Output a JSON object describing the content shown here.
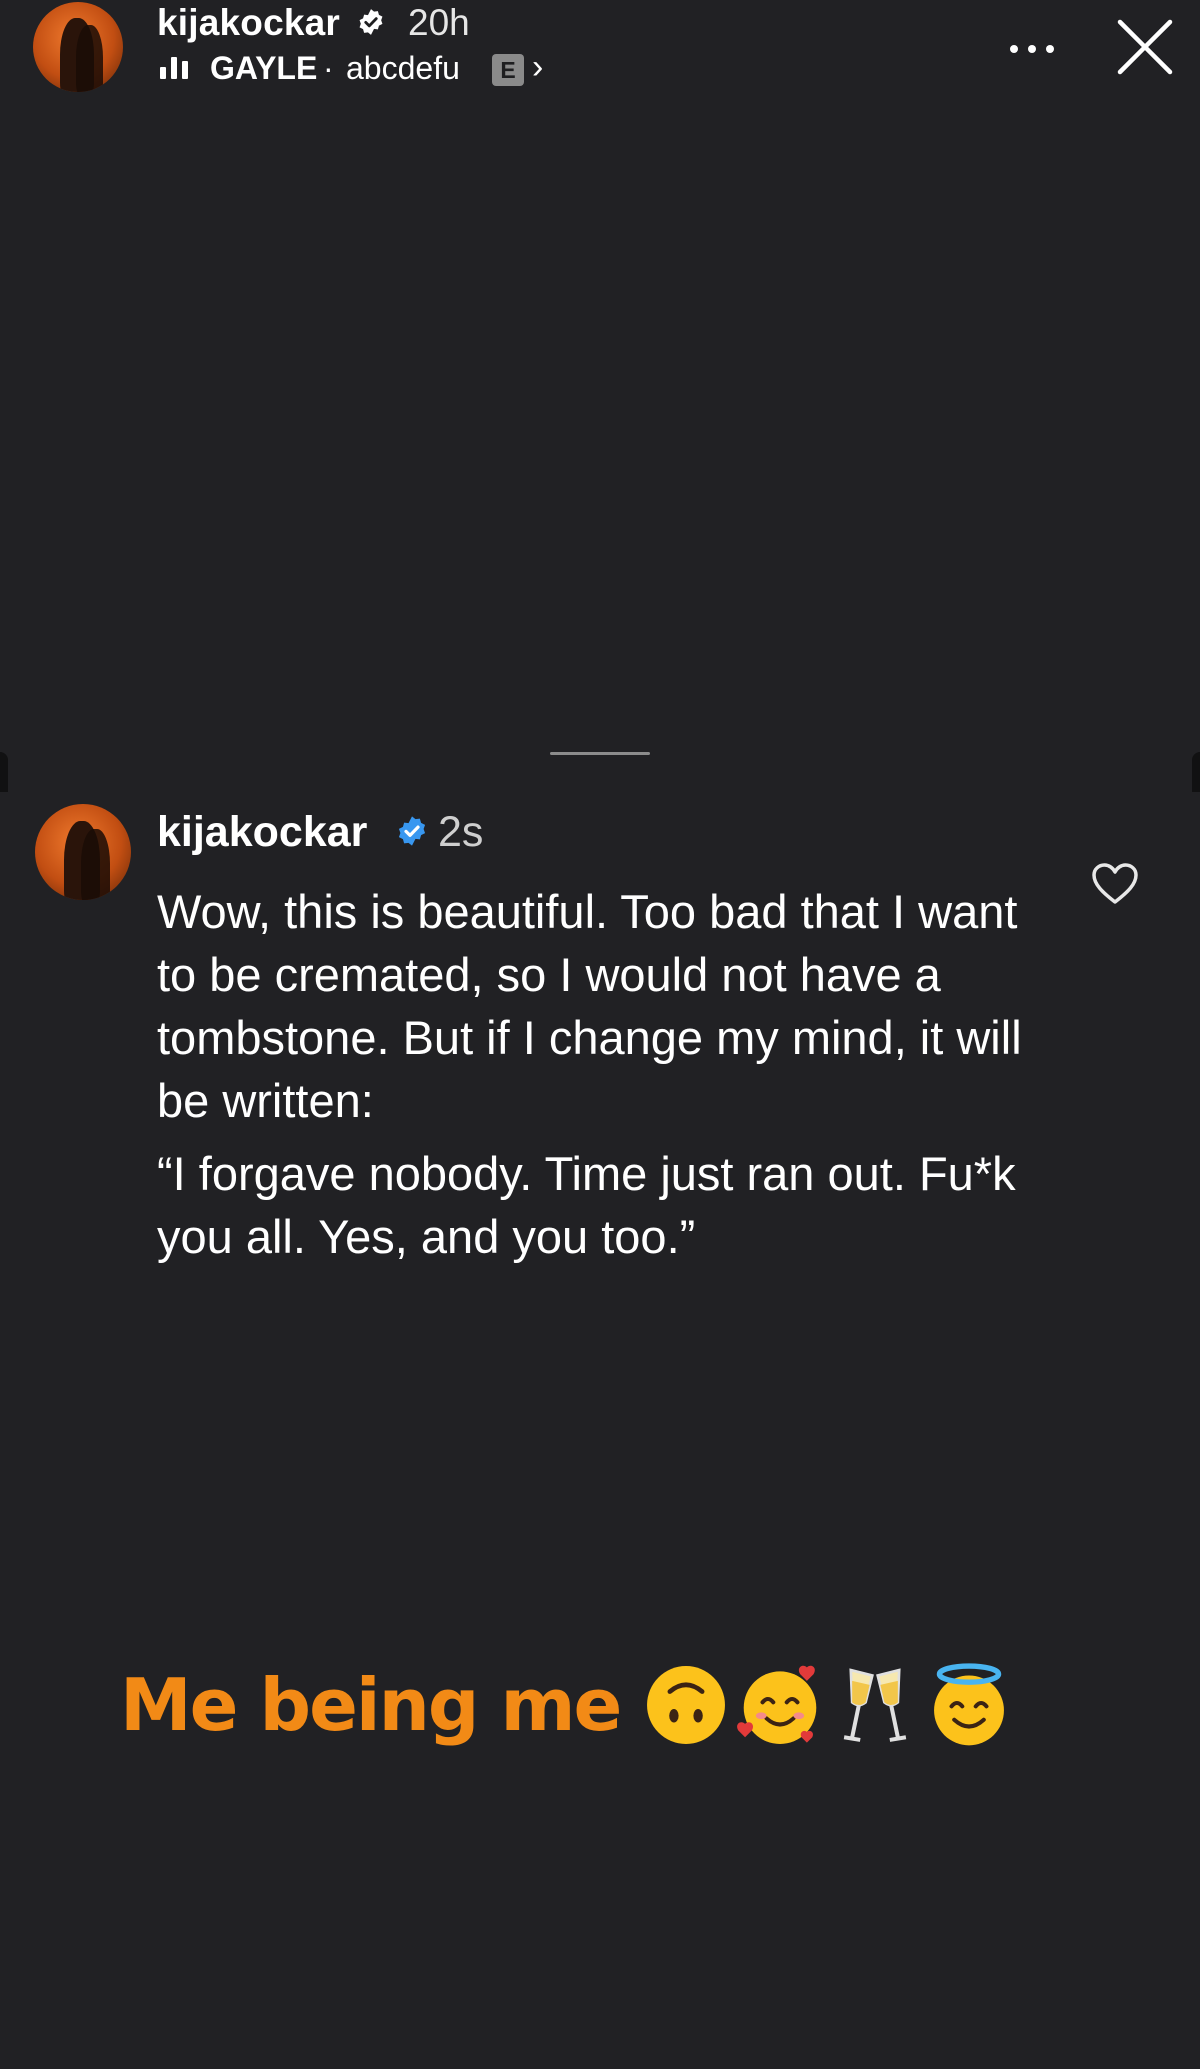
{
  "story_header": {
    "username": "kijakockar",
    "time_ago": "20h",
    "music": {
      "artist": "GAYLE",
      "separator": "·",
      "song": "abcdefu",
      "explicit_badge": "E",
      "chevron": "›"
    },
    "icons": [
      "avatar",
      "verified-badge-icon",
      "equalizer-icon",
      "more-options-icon",
      "close-icon"
    ]
  },
  "comment": {
    "username": "kijakockar",
    "time_ago": "2s",
    "paragraph_1": "Wow, this is beautiful. Too bad that I want to be cremated, so I would not have a tombstone. But if I change my mind, it will be written:",
    "paragraph_2": "“I forgave nobody. Time just ran out. Fu*k you all. Yes, and you too.”",
    "icons": [
      "verified-badge-icon",
      "heart-icon"
    ]
  },
  "caption": {
    "text": "Me being me",
    "emojis": [
      "upside-down-face",
      "smiling-face-with-hearts",
      "clinking-glasses",
      "smiling-face-with-halo"
    ],
    "color": "#f28a16"
  },
  "colors": {
    "background": "#212124",
    "verified_blue": "#3897f0",
    "text": "#ffffff"
  }
}
